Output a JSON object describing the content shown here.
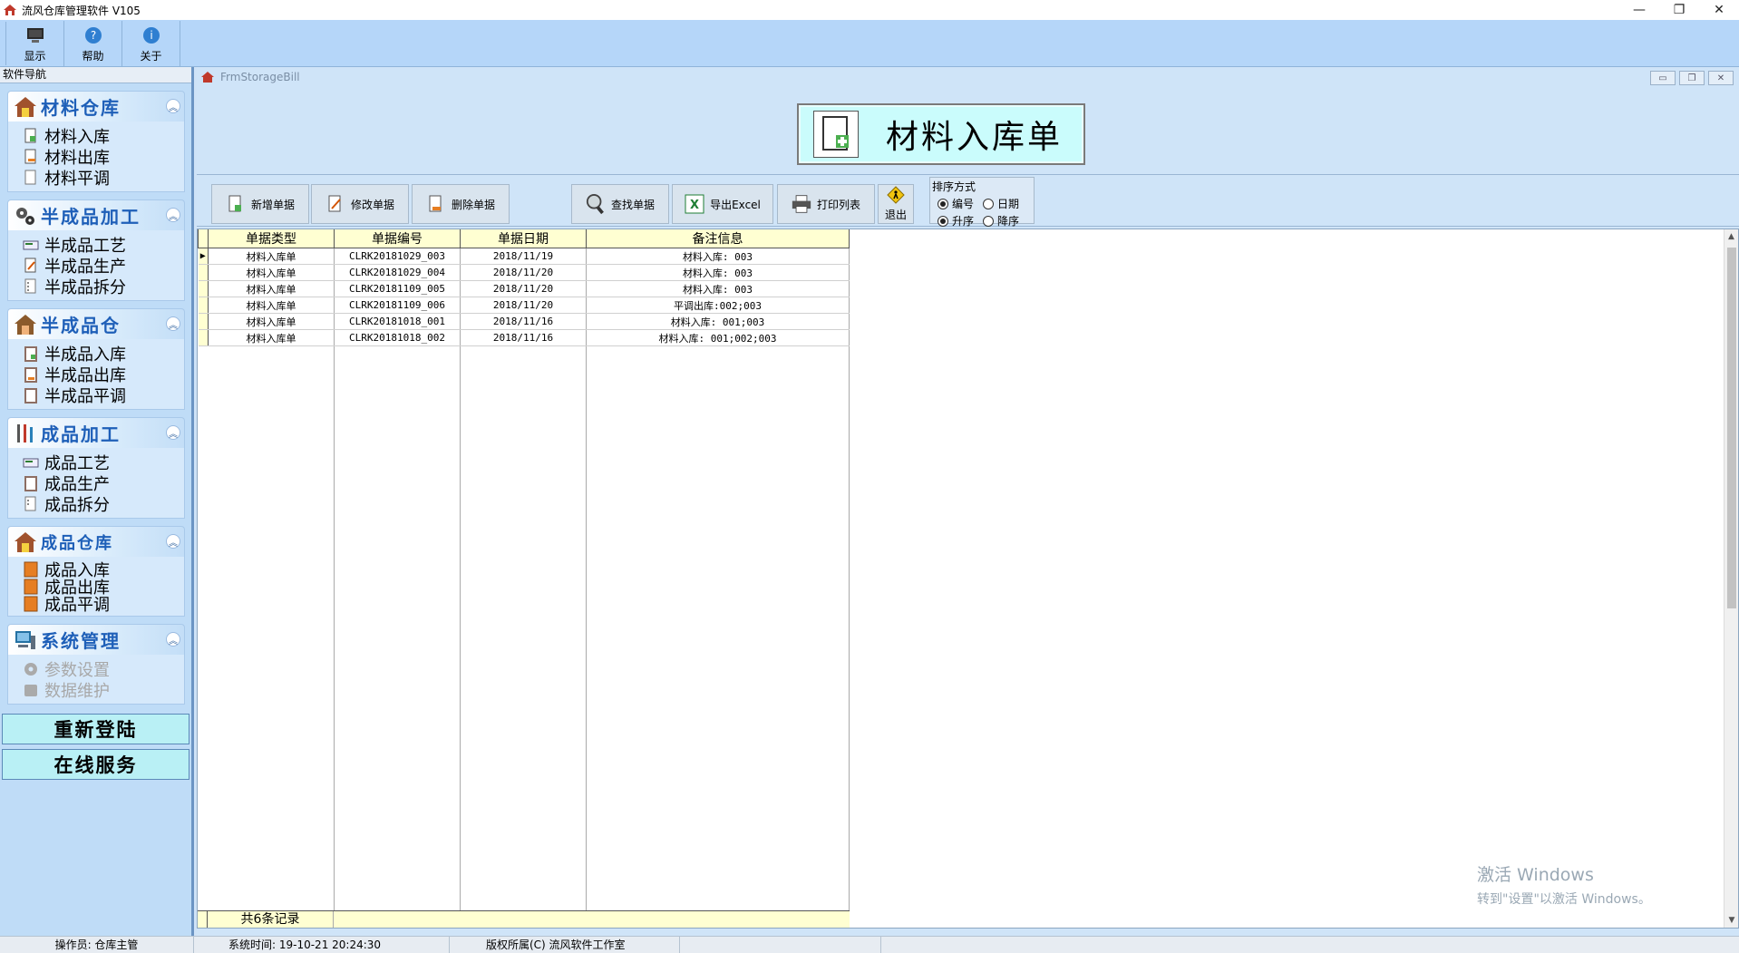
{
  "window": {
    "title": "流风仓库管理软件 V105",
    "minimize": "—",
    "maximize": "❐",
    "close": "✕"
  },
  "toolbar": {
    "items": [
      {
        "label": "显示",
        "icon": "monitor-icon"
      },
      {
        "label": "帮助",
        "icon": "help-icon"
      },
      {
        "label": "关于",
        "icon": "info-icon"
      }
    ]
  },
  "nav": {
    "header": "软件导航",
    "groups": [
      {
        "title": "材料仓库",
        "items": [
          "材料入库",
          "材料出库",
          "材料平调"
        ]
      },
      {
        "title": "半成品加工",
        "items": [
          "半成品工艺",
          "半成品生产",
          "半成品拆分"
        ]
      },
      {
        "title": "半成品仓",
        "items": [
          "半成品入库",
          "半成品出库",
          "半成品平调"
        ]
      },
      {
        "title": "成品加工",
        "items": [
          "成品工艺",
          "成品生产",
          "成品拆分"
        ]
      },
      {
        "title": "成品仓库",
        "items": [
          "成品入库",
          "成品出库",
          "成品平调"
        ]
      },
      {
        "title": "系统管理",
        "items": [
          "参数设置",
          "数据维护"
        ]
      }
    ],
    "relogin": "重新登陆",
    "online_service": "在线服务"
  },
  "child": {
    "title": "FrmStorageBill",
    "form_title": "材料入库单",
    "buttons": {
      "add": "新增单据",
      "edit": "修改单据",
      "delete": "删除单据",
      "search": "查找单据",
      "export": "导出Excel",
      "print": "打印列表",
      "exit": "退出"
    },
    "sort": {
      "title": "排序方式",
      "by_number": "编号",
      "by_date": "日期",
      "asc": "升序",
      "desc": "降序",
      "selected_key": "编号",
      "selected_order": "升序"
    },
    "grid": {
      "columns": [
        "单据类型",
        "单据编号",
        "单据日期",
        "备注信息"
      ],
      "rows": [
        [
          "材料入库单",
          "CLRK20181029_003",
          "2018/11/19",
          "材料入库: 003"
        ],
        [
          "材料入库单",
          "CLRK20181029_004",
          "2018/11/20",
          "材料入库: 003"
        ],
        [
          "材料入库单",
          "CLRK20181109_005",
          "2018/11/20",
          "材料入库: 003"
        ],
        [
          "材料入库单",
          "CLRK20181109_006",
          "2018/11/20",
          "平调出库:002;003"
        ],
        [
          "材料入库单",
          "CLRK20181018_001",
          "2018/11/16",
          "材料入库: 001;003"
        ],
        [
          "材料入库单",
          "CLRK20181018_002",
          "2018/11/16",
          "材料入库: 001;002;003"
        ]
      ],
      "footer": "共6条记录"
    }
  },
  "watermark": {
    "line1": "激活 Windows",
    "line2": "转到\"设置\"以激活 Windows。"
  },
  "status": {
    "operator": "操作员: 仓库主管",
    "time": "系统时间: 19-10-21 20:24:30",
    "copyright": "版权所属(C) 流风软件工作室"
  }
}
